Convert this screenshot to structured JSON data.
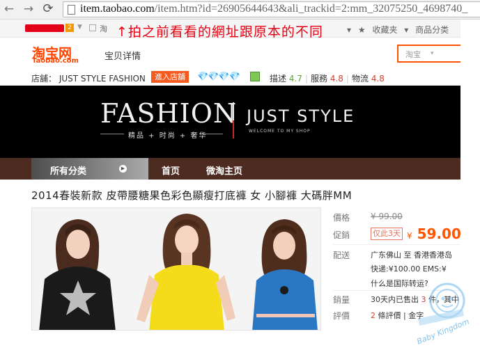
{
  "browser": {
    "url_host": "item.taobao.com",
    "url_path": "/item.htm?id=26905644643&ali_trackid=2:mm_32075250_4698740_"
  },
  "top_strip": {
    "fragment": "淘",
    "annotation": "↑拍之前看看的網址跟原本的不同",
    "favorites": "收藏夹",
    "categories": "商品分类"
  },
  "header": {
    "logo": "淘宝网",
    "logo_sub": "Taobao.com",
    "page_tag": "宝贝详情",
    "search_scope": "淘宝"
  },
  "shop": {
    "name_label": "店舖：",
    "name": "JUST STYLE FASHION",
    "enter_button": "進入店舖",
    "diamonds": "💎💎💎💎",
    "ratings": [
      {
        "label": "描述",
        "value": "4.7",
        "color": "#5aa63a"
      },
      {
        "label": "服務",
        "value": "4.8",
        "color": "#d3402e"
      },
      {
        "label": "物流",
        "value": "4.8",
        "color": "#d3402e"
      }
    ]
  },
  "banner": {
    "fashion": "FASHION",
    "just_style": "JUST STYLE",
    "subtitle": "精品 + 时尚 + 奢华",
    "welcome": "WELCOME TO MY SHOP"
  },
  "nav": {
    "all_categories": "所有分类",
    "home": "首页",
    "weitao": "微淘主页"
  },
  "product": {
    "title": "2014春裝新款 皮帶腰糖果色彩色顯瘦打底褲 女 小腳褲 大碼胖MM",
    "price_label": "價格",
    "price_original": "¥ 99.00",
    "promo_label": "促銷",
    "promo_tag": "仅此3天",
    "price_now_symbol": "¥",
    "price_now": "59.00",
    "shipping_label": "配送",
    "shipping_route": "广东佛山 至  香港香港岛",
    "shipping_fees": "快递:¥100.00  EMS:¥",
    "intl_link": "什么是国际转运?",
    "sales_label": "銷量",
    "sales_text_a": "30天内已售出",
    "sales_count": "3",
    "sales_text_b": "件，其中",
    "reviews_label": "評價",
    "reviews_count": "2",
    "reviews_text": "條評價",
    "reviews_extra": "金字"
  },
  "watermark": {
    "brand": "Baby Kingdom"
  },
  "colors": {
    "taobao_orange": "#ff4400",
    "price_orange": "#ff5500",
    "nav_brown": "#4e2b20"
  }
}
